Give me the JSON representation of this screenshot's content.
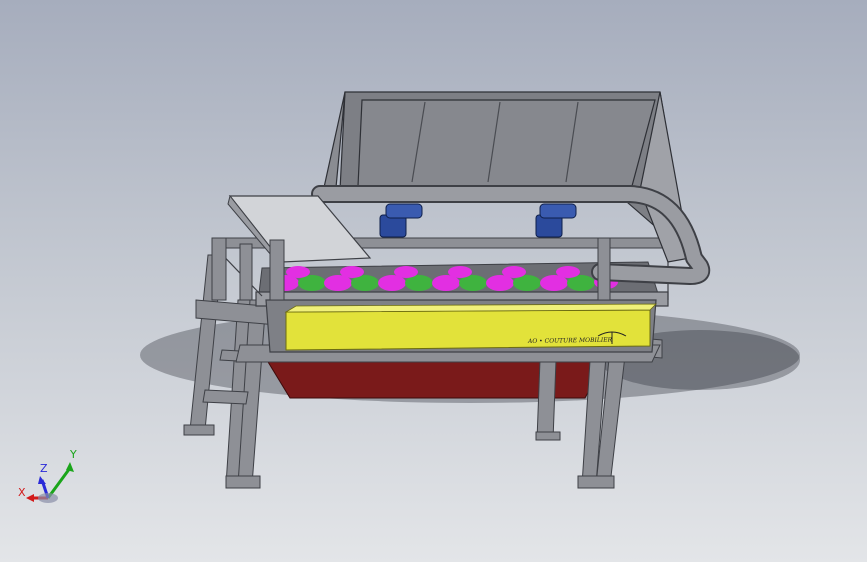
{
  "viewport": {
    "background_top": "#a6adbd",
    "background_bottom": "#e3e5e8"
  },
  "model": {
    "beam_label": "AO • COUTURE MOBILIER",
    "colors": {
      "frame": "#8e9096",
      "frame_dark": "#5f6167",
      "cover": "#7d7f85",
      "cover_plate": "#d2d4d8",
      "beam": "#e2e23a",
      "rollers_magenta": "#e22fe2",
      "rollers_green": "#3fb33f",
      "hopper": "#7a1a1a",
      "motor": "#2b4a9c"
    }
  },
  "triad": {
    "x_label": "X",
    "y_label": "Y",
    "z_label": "Z",
    "x_color": "#d21a1a",
    "y_color": "#1aa51a",
    "z_color": "#2a2ad8"
  }
}
